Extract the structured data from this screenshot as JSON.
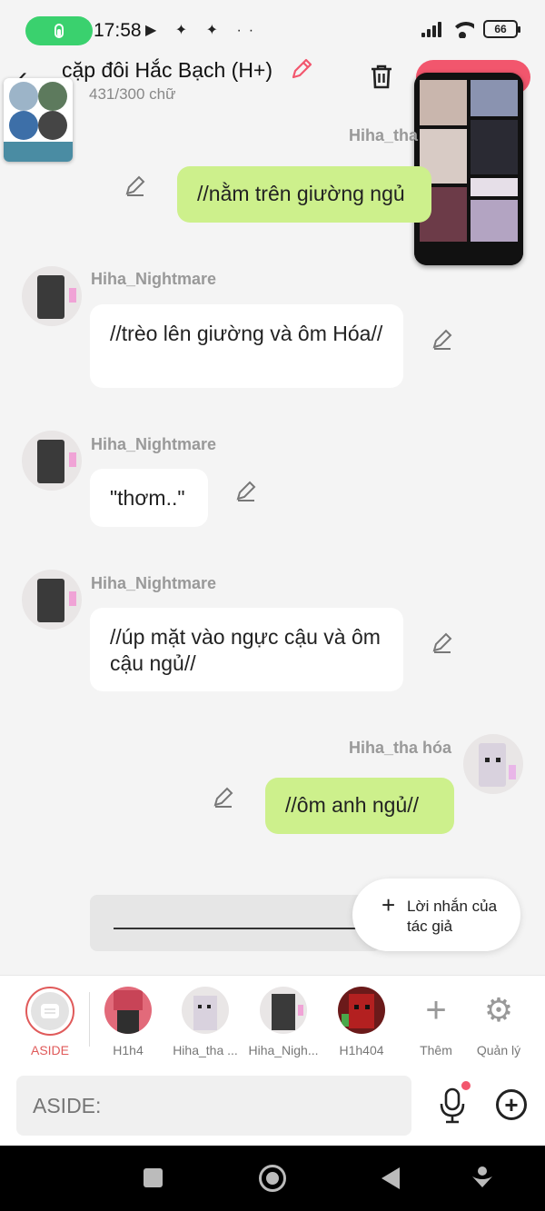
{
  "status_bar": {
    "time": "17:58",
    "extra_icons": "▶ ✦ ✦ ··",
    "battery": "66"
  },
  "header": {
    "title": "cặp đôi Hắc Bạch (H+)",
    "word_count": "431/300 chữ"
  },
  "messages": [
    {
      "side": "right",
      "sender": "Hiha_tha",
      "text": "//nằm trên giường ngủ"
    },
    {
      "side": "left",
      "sender": "Hiha_Nightmare",
      "text": "//trèo lên giường và ôm Hóa//"
    },
    {
      "side": "left",
      "sender": "Hiha_Nightmare",
      "text": "\"thơm..\""
    },
    {
      "side": "left",
      "sender": "Hiha_Nightmare",
      "text": "//úp mặt vào ngực cậu và ôm cậu ngủ//"
    },
    {
      "side": "right",
      "sender": "Hiha_tha hóa",
      "text": "//ôm anh ngủ//"
    }
  ],
  "author_note": {
    "label": "Lời nhắn của tác giả"
  },
  "characters": [
    {
      "label": "ASIDE"
    },
    {
      "label": "H1h4"
    },
    {
      "label": "Hiha_tha ..."
    },
    {
      "label": "Hiha_Nigh..."
    },
    {
      "label": "H1h404"
    },
    {
      "label": "Thêm"
    },
    {
      "label": "Quản lý"
    }
  ],
  "input": {
    "placeholder": "ASIDE:"
  },
  "colors": {
    "accent_red": "#f2566d",
    "bubble_green": "#cdf08c",
    "mic_green": "#3ad16e"
  }
}
